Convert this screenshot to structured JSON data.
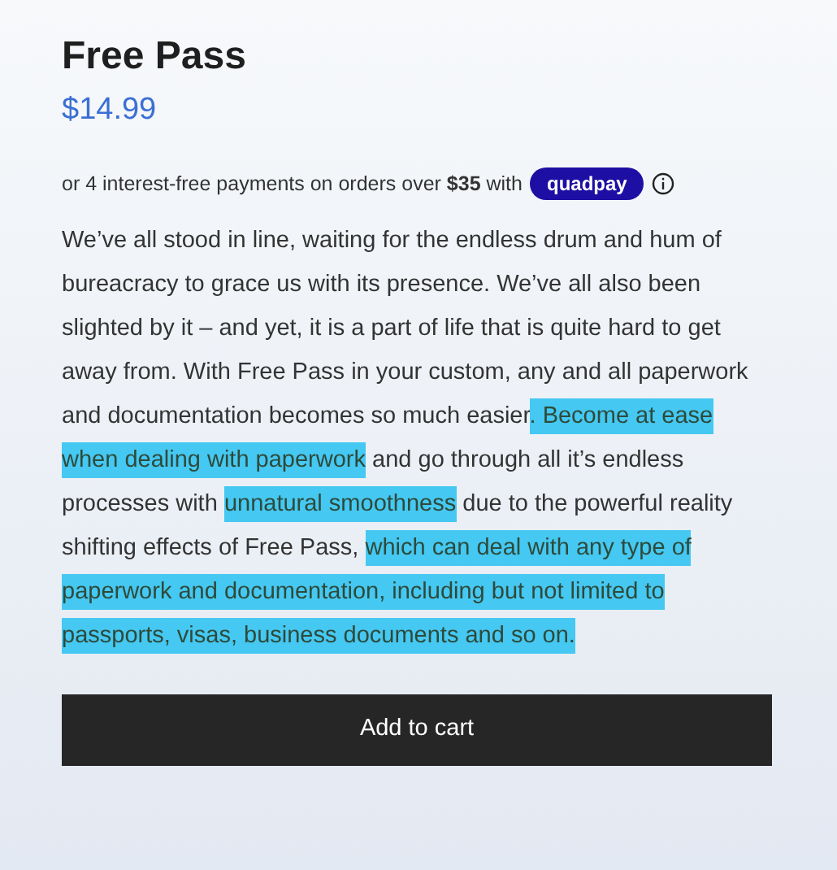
{
  "product": {
    "title": "Free Pass",
    "price": "$14.99"
  },
  "installments": {
    "text": "or 4 interest-free payments on orders over **$35** with",
    "provider": "quadpay",
    "info_icon": true
  },
  "description": [
    {
      "text": "We’ve all stood in line, waiting for the endless drum and hum of bureacracy to grace us with its presence. We’ve all also been slighted by it – and yet, it is a part of life that is quite hard to get away from. With Free Pass in your custom, any and all paperwork and documentation becomes so much easier",
      "highlighted": false
    },
    {
      "text": ". Become at ease when dealing with paperwork",
      "highlighted": true
    },
    {
      "text": " and go through all it’s endless processes with ",
      "highlighted": false
    },
    {
      "text": "unnatural smoothness",
      "highlighted": true
    },
    {
      "text": " due to the powerful reality shifting effects of Free Pass, ",
      "highlighted": false
    },
    {
      "text": "which can deal with any type of paperwork and documentation, including but not limited to passports, visas, business documents and so on.",
      "highlighted": true
    }
  ],
  "add_to_cart_button": "Add to cart"
}
